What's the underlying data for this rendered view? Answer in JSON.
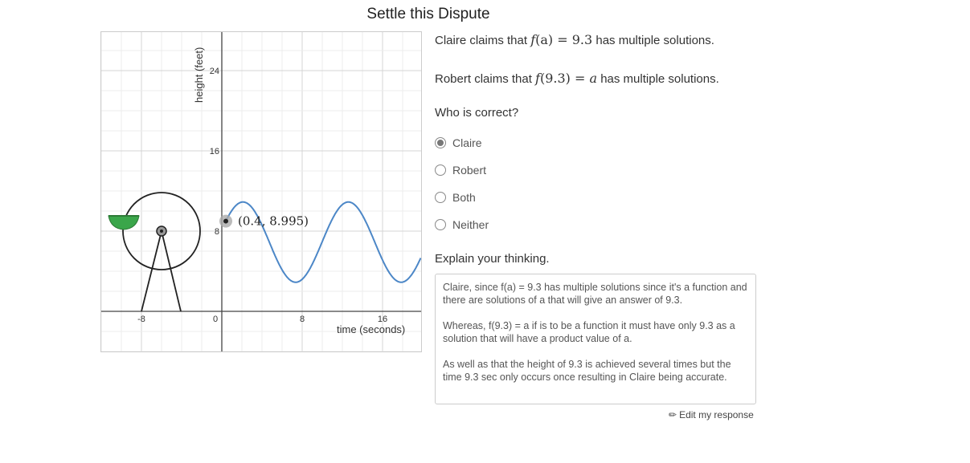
{
  "title": "Settle this Dispute",
  "graph": {
    "x_axis_label": "time (seconds)",
    "y_axis_label": "height (feet)",
    "x_ticks": [
      "-8",
      "0",
      "8",
      "16"
    ],
    "y_ticks": [
      "24",
      "16",
      "8"
    ],
    "point_label": "(0.4, 8.995)",
    "curve_color": "#4c87c7",
    "seat_color": "#3aa64a",
    "x_range": [
      -9,
      20
    ],
    "y_range": [
      -4,
      28
    ],
    "point": {
      "x": 0.4,
      "y": 8.995
    }
  },
  "claims": {
    "claire_prefix": "Claire claims that ",
    "claire_f": "f",
    "claire_arg": "(a)",
    "claire_eq": " = 9.3",
    "claire_suffix": " has multiple solutions.",
    "robert_prefix": "Robert claims that ",
    "robert_f": "f",
    "robert_arg": "(9.3)",
    "robert_eq": " = a",
    "robert_suffix": " has multiple solutions."
  },
  "question": "Who is correct?",
  "options": [
    {
      "label": "Claire",
      "selected": true
    },
    {
      "label": "Robert",
      "selected": false
    },
    {
      "label": "Both",
      "selected": false
    },
    {
      "label": "Neither",
      "selected": false
    }
  ],
  "explain_label": "Explain your thinking.",
  "response": {
    "p1": "Claire, since f(a) = 9.3 has multiple solutions since it's a function and there are solutions of a that will give an answer of 9.3.",
    "p2": "Whereas, f(9.3) = a if is to be a function it must have only 9.3 as a solution that will have a product value of a.",
    "p3": "As well as that the height of 9.3 is achieved several times but the time 9.3 sec only occurs once resulting in Claire being accurate."
  },
  "edit_label": "Edit my response"
}
